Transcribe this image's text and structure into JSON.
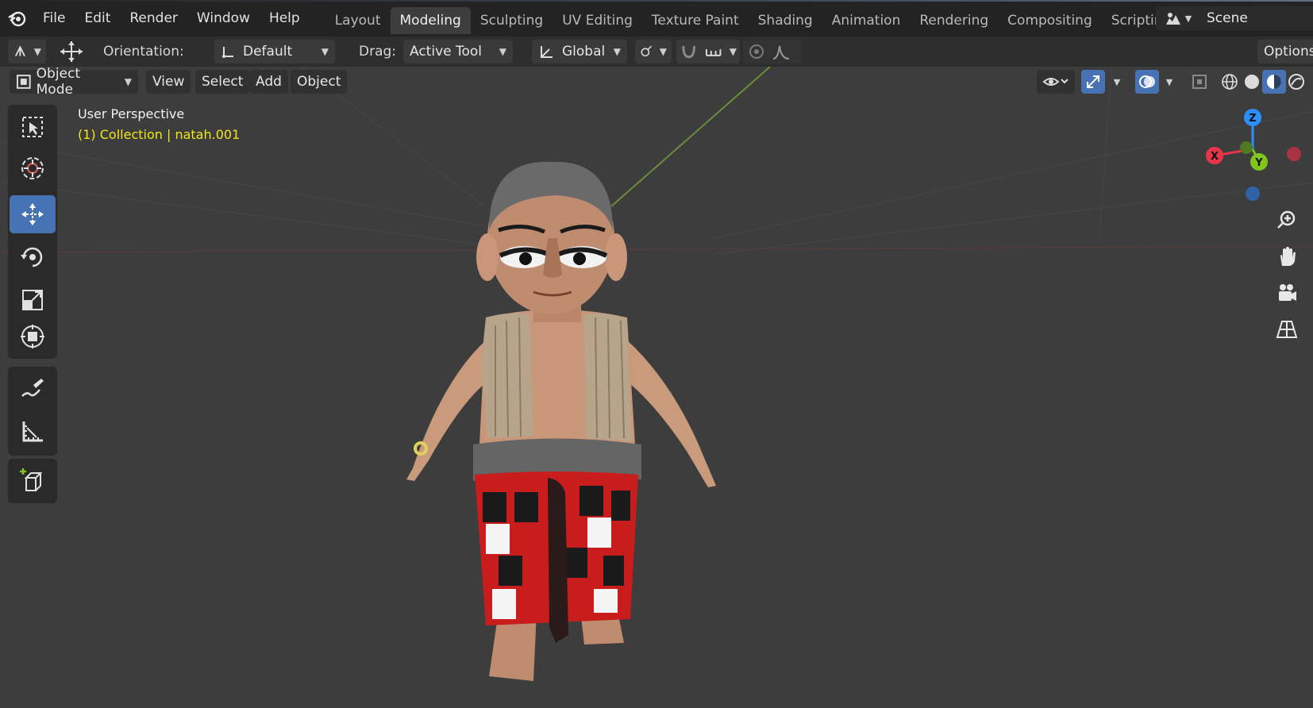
{
  "menu": {
    "file": "File",
    "edit": "Edit",
    "render": "Render",
    "window": "Window",
    "help": "Help"
  },
  "workspace_tabs": [
    {
      "label": "Layout",
      "active": false
    },
    {
      "label": "Modeling",
      "active": true
    },
    {
      "label": "Sculpting",
      "active": false
    },
    {
      "label": "UV Editing",
      "active": false
    },
    {
      "label": "Texture Paint",
      "active": false
    },
    {
      "label": "Shading",
      "active": false
    },
    {
      "label": "Animation",
      "active": false
    },
    {
      "label": "Rendering",
      "active": false
    },
    {
      "label": "Compositing",
      "active": false
    },
    {
      "label": "Scripting",
      "active": false
    }
  ],
  "scene": {
    "name": "Scene"
  },
  "toolheader": {
    "orientation_label": "Orientation:",
    "orientation_value": "Default",
    "drag_label": "Drag:",
    "drag_value": "Active Tool",
    "transform_orientation": "Global",
    "options": "Options"
  },
  "viewport_header": {
    "mode": "Object Mode",
    "view": "View",
    "select": "Select",
    "add": "Add",
    "object": "Object"
  },
  "viewport": {
    "title": "User Perspective",
    "collection_info": "(1) Collection | natah.001"
  },
  "gizmo": {
    "x": "X",
    "y": "Y",
    "z": "Z"
  },
  "colors": {
    "accent": "#4772b3",
    "axis_x": "#e7344b",
    "axis_y": "#82c51d",
    "axis_z": "#2c8fff",
    "info_text": "#f2e61a"
  },
  "icons": {
    "tools": [
      "select-box-icon",
      "cursor-icon",
      "move-icon",
      "rotate-icon",
      "scale-icon",
      "transform-icon",
      "annotate-icon",
      "measure-icon",
      "add-cube-icon"
    ],
    "nav": [
      "zoom-icon",
      "pan-hand-icon",
      "camera-icon",
      "grid-icon"
    ]
  }
}
